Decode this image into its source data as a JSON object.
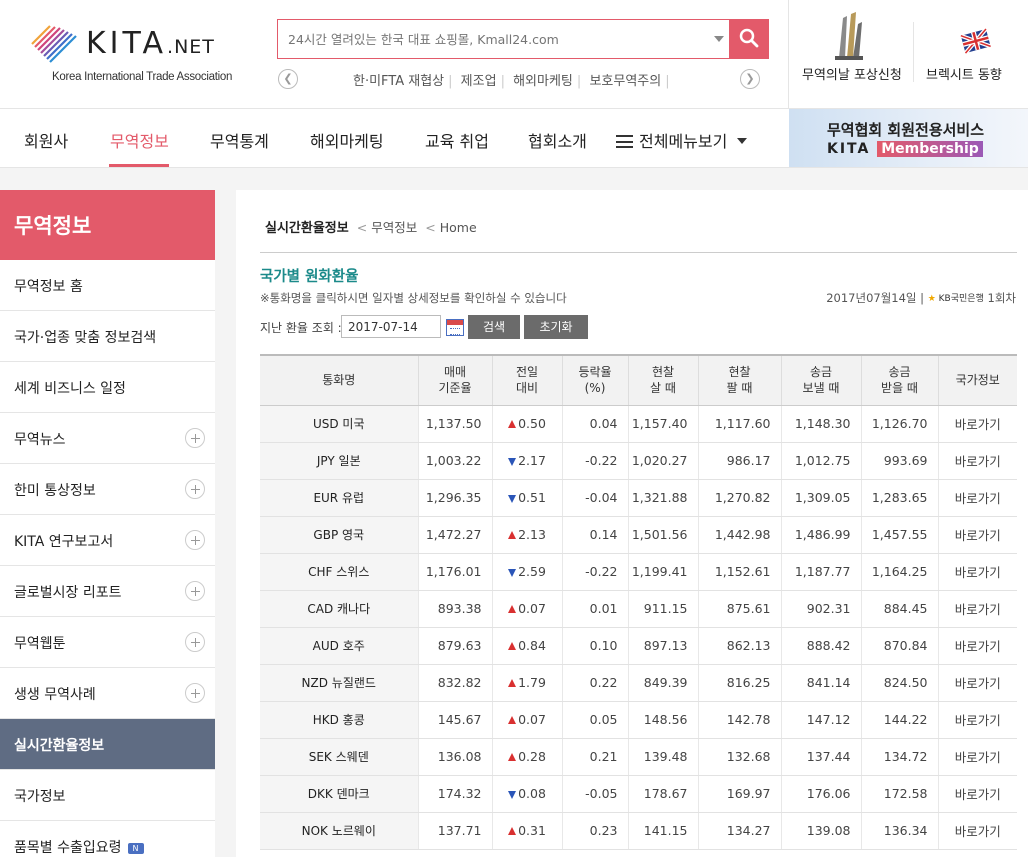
{
  "brand": {
    "logo_text": "KITA",
    "logo_suffix": ".NET",
    "logo_sub": "Korea International Trade Association",
    "accent": "#e35a6a"
  },
  "search": {
    "placeholder": "24시간 열려있는 한국 대표 쇼핑몰, Kmall24.com",
    "keywords": [
      "한·미FTA 재협상",
      "제조업",
      "해외마케팅",
      "보호무역주의"
    ]
  },
  "promo": {
    "award_label": "무역의날 포상신청",
    "brexit_label": "브렉시트 동향"
  },
  "nav": {
    "items": [
      "회원사",
      "무역정보",
      "무역통계",
      "해외마케팅",
      "교육 취업",
      "협회소개"
    ],
    "all_menu": "전체메뉴보기",
    "active": "무역정보"
  },
  "membership": {
    "line1": "무역협회 회원전용서비스",
    "line2_a": "KITA",
    "line2_b": "Membership"
  },
  "sidebar": {
    "title": "무역정보",
    "items": [
      {
        "label": "무역정보 홈",
        "expand": false
      },
      {
        "label": "국가·업종 맞춤 정보검색",
        "expand": false
      },
      {
        "label": "세계 비즈니스 일정",
        "expand": false
      },
      {
        "label": "무역뉴스",
        "expand": true
      },
      {
        "label": "한미 통상정보",
        "expand": true
      },
      {
        "label": "KITA 연구보고서",
        "expand": true
      },
      {
        "label": "글로벌시장 리포트",
        "expand": true
      },
      {
        "label": "무역웹툰",
        "expand": true
      },
      {
        "label": "생생 무역사례",
        "expand": true
      },
      {
        "label": "실시간환율정보",
        "expand": false
      },
      {
        "label": "국가정보",
        "expand": false
      },
      {
        "label": "품목별 수출입요령",
        "expand": false
      }
    ],
    "active": "실시간환율정보",
    "new_badge": "N"
  },
  "breadcrumb": {
    "current": "실시간환율정보",
    "parent": "무역정보",
    "home": "Home"
  },
  "section": {
    "title": "국가별 원화환율",
    "note": "※통화명을 클릭하시면 일자별 상세정보를 확인하실 수 있습니다",
    "date": "2017년07월14일",
    "bank": "KB국민은행",
    "round": "1회차",
    "query_label": "지난 환율 조회 :",
    "query_date": "2017-07-14",
    "search_btn": "검색",
    "reset_btn": "초기화"
  },
  "table": {
    "headers": [
      [
        "통화명"
      ],
      [
        "매매",
        "기준율"
      ],
      [
        "전일",
        "대비"
      ],
      [
        "등락율",
        "(%)"
      ],
      [
        "현찰",
        "살 때"
      ],
      [
        "현찰",
        "팔 때"
      ],
      [
        "송금",
        "보낼 때"
      ],
      [
        "송금",
        "받을 때"
      ],
      [
        "국가정보"
      ]
    ],
    "link_label": "바로가기",
    "rows": [
      {
        "currency": "USD 미국",
        "base": "1,137.50",
        "dir": "up",
        "change": "0.50",
        "pct": "0.04",
        "cash_buy": "1,157.40",
        "cash_sell": "1,117.60",
        "send": "1,148.30",
        "receive": "1,126.70"
      },
      {
        "currency": "JPY 일본",
        "base": "1,003.22",
        "dir": "down",
        "change": "2.17",
        "pct": "-0.22",
        "cash_buy": "1,020.27",
        "cash_sell": "986.17",
        "send": "1,012.75",
        "receive": "993.69"
      },
      {
        "currency": "EUR 유럽",
        "base": "1,296.35",
        "dir": "down",
        "change": "0.51",
        "pct": "-0.04",
        "cash_buy": "1,321.88",
        "cash_sell": "1,270.82",
        "send": "1,309.05",
        "receive": "1,283.65"
      },
      {
        "currency": "GBP 영국",
        "base": "1,472.27",
        "dir": "up",
        "change": "2.13",
        "pct": "0.14",
        "cash_buy": "1,501.56",
        "cash_sell": "1,442.98",
        "send": "1,486.99",
        "receive": "1,457.55"
      },
      {
        "currency": "CHF 스위스",
        "base": "1,176.01",
        "dir": "down",
        "change": "2.59",
        "pct": "-0.22",
        "cash_buy": "1,199.41",
        "cash_sell": "1,152.61",
        "send": "1,187.77",
        "receive": "1,164.25"
      },
      {
        "currency": "CAD 캐나다",
        "base": "893.38",
        "dir": "up",
        "change": "0.07",
        "pct": "0.01",
        "cash_buy": "911.15",
        "cash_sell": "875.61",
        "send": "902.31",
        "receive": "884.45"
      },
      {
        "currency": "AUD 호주",
        "base": "879.63",
        "dir": "up",
        "change": "0.84",
        "pct": "0.10",
        "cash_buy": "897.13",
        "cash_sell": "862.13",
        "send": "888.42",
        "receive": "870.84"
      },
      {
        "currency": "NZD 뉴질랜드",
        "base": "832.82",
        "dir": "up",
        "change": "1.79",
        "pct": "0.22",
        "cash_buy": "849.39",
        "cash_sell": "816.25",
        "send": "841.14",
        "receive": "824.50"
      },
      {
        "currency": "HKD 홍콩",
        "base": "145.67",
        "dir": "up",
        "change": "0.07",
        "pct": "0.05",
        "cash_buy": "148.56",
        "cash_sell": "142.78",
        "send": "147.12",
        "receive": "144.22"
      },
      {
        "currency": "SEK 스웨덴",
        "base": "136.08",
        "dir": "up",
        "change": "0.28",
        "pct": "0.21",
        "cash_buy": "139.48",
        "cash_sell": "132.68",
        "send": "137.44",
        "receive": "134.72"
      },
      {
        "currency": "DKK 덴마크",
        "base": "174.32",
        "dir": "down",
        "change": "0.08",
        "pct": "-0.05",
        "cash_buy": "178.67",
        "cash_sell": "169.97",
        "send": "176.06",
        "receive": "172.58"
      },
      {
        "currency": "NOK 노르웨이",
        "base": "137.71",
        "dir": "up",
        "change": "0.31",
        "pct": "0.23",
        "cash_buy": "141.15",
        "cash_sell": "134.27",
        "send": "139.08",
        "receive": "136.34"
      }
    ]
  }
}
